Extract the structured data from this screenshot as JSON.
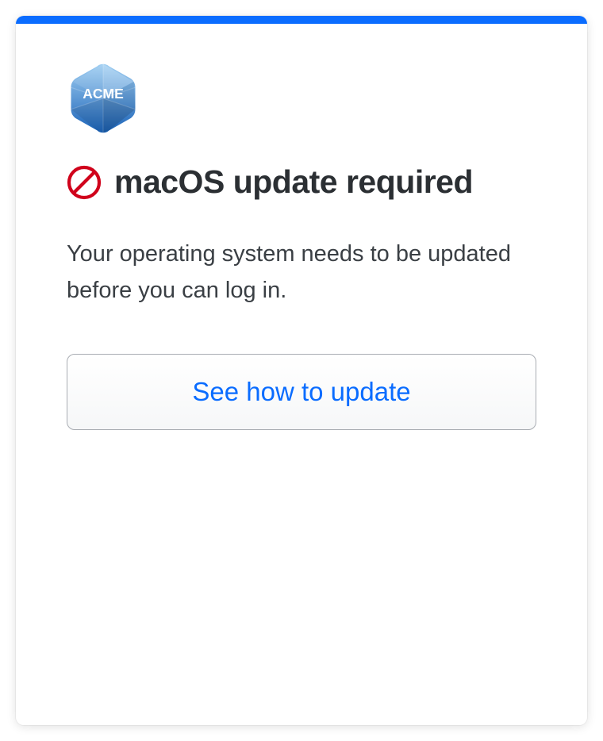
{
  "brand": {
    "name": "ACME"
  },
  "dialog": {
    "title": "macOS update required",
    "body": "Your operating system needs to be updated before you can log in.",
    "cta": "See how to update"
  },
  "colors": {
    "accent": "#0a6cff",
    "error": "#d0021b"
  }
}
